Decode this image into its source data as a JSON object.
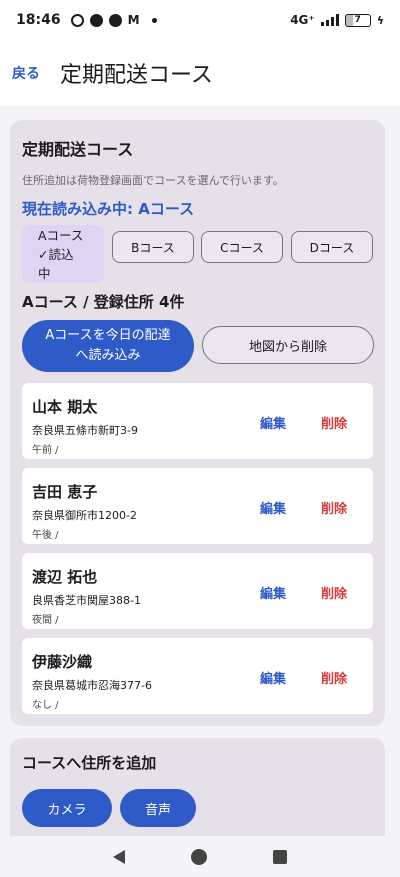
{
  "status_bar": {
    "time": "18:46",
    "network": "4G⁺",
    "battery": "7"
  },
  "app_bar": {
    "back_label": "戻る",
    "title": "定期配送コース"
  },
  "main_card": {
    "title": "定期配送コース",
    "description": "住所追加は荷物登録画面でコースを選んで行います。",
    "current_course": "現在読み込み中: Aコース",
    "course_tabs": [
      {
        "label_lines": [
          "Aコース",
          "✓読込",
          "中"
        ],
        "selected": true
      },
      {
        "label": "Bコース",
        "selected": false
      },
      {
        "label": "Cコース",
        "selected": false
      },
      {
        "label": "Dコース",
        "selected": false
      }
    ],
    "list_title": "Aコース / 登録住所 4件",
    "load_button": "Aコースを今日の配達へ読み込み",
    "remove_button": "地図から削除",
    "addresses": [
      {
        "name": "山本 期太",
        "address": "奈良県五條市新町3-9",
        "time": "午前 /",
        "edit": "編集",
        "delete": "削除"
      },
      {
        "name": "吉田 恵子",
        "address": "奈良県御所市1200-2",
        "time": "午後 /",
        "edit": "編集",
        "delete": "削除"
      },
      {
        "name": "渡辺 拓也",
        "address": "良県香芝市関屋388-1",
        "time": "夜間 /",
        "edit": "編集",
        "delete": "削除"
      },
      {
        "name": "伊藤沙織",
        "address": "奈良県葛城市忍海377-6",
        "time": "なし /",
        "edit": "編集",
        "delete": "削除"
      }
    ]
  },
  "add_card": {
    "title": "コースへ住所を追加",
    "camera_button": "カメラ",
    "voice_button": "音声"
  },
  "colors": {
    "accent": "#2e5bc8",
    "danger": "#d33d3d",
    "card_bg": "#e6e0e9"
  }
}
